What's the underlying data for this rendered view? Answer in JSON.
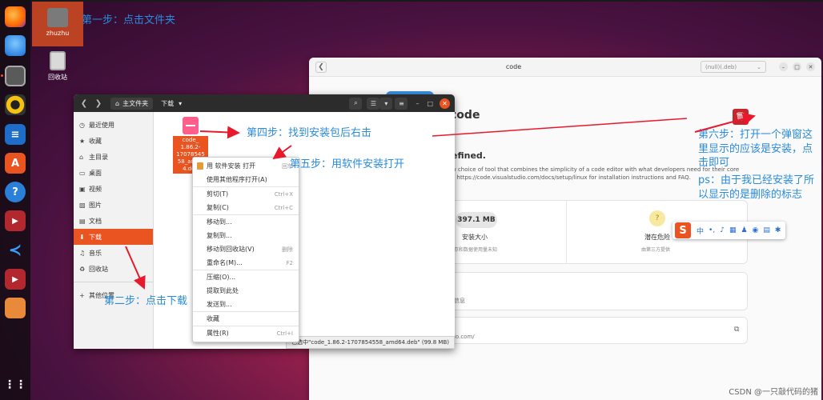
{
  "desktop": {
    "home_folder_label": "zhuzhu",
    "trash_label": "回收站"
  },
  "annotations": {
    "step1": "第一步：点击文件夹",
    "step2": "第二步：点击下载",
    "step4": "第四步：找到安装包后右击",
    "step5": "第五步：用软件安装打开",
    "step6": "第六步：打开一个弹窗这里显示的应该是安装，点击即可",
    "note": "ps：由于我已经安装了所以显示的是删除的标志"
  },
  "software_center": {
    "title": "code",
    "source_select": "(null)(.deb)",
    "app_name": "code",
    "subtitle": "efined.",
    "description_line1": "w choice of tool that combines the simplicity of a code editor with what developers need for their core",
    "description_line2": "e https://code.visualstudio.com/docs/setup/linux for installation instructions and FAQ.",
    "install_size_value": "397.1 MB",
    "install_size_label": "安装大小",
    "install_size_note": "存和数据使用量未知",
    "risk_label": "潜在危险",
    "risk_note": "由第三方提供",
    "info_text": "信息",
    "link_text": "io.com/"
  },
  "file_manager": {
    "path_home": "主文件夹",
    "path_current": "下载",
    "sidebar": [
      {
        "icon": "clock-icon",
        "glyph": "◷",
        "label": "最近使用"
      },
      {
        "icon": "star-icon",
        "glyph": "★",
        "label": "收藏"
      },
      {
        "icon": "home-icon",
        "glyph": "⌂",
        "label": "主目录"
      },
      {
        "icon": "desktop-icon",
        "glyph": "▭",
        "label": "桌面"
      },
      {
        "icon": "video-icon",
        "glyph": "▣",
        "label": "视频"
      },
      {
        "icon": "picture-icon",
        "glyph": "▨",
        "label": "图片"
      },
      {
        "icon": "document-icon",
        "glyph": "▤",
        "label": "文档"
      },
      {
        "icon": "download-icon",
        "glyph": "⬇",
        "label": "下载"
      },
      {
        "icon": "music-icon",
        "glyph": "♫",
        "label": "音乐"
      },
      {
        "icon": "trash-icon",
        "glyph": "♻",
        "label": "回收站"
      },
      {
        "icon": "plus-icon",
        "glyph": "+",
        "label": "其他位置"
      }
    ],
    "file_name": "code_1.86.2-1707854558_amd64.deb",
    "file_name_display": [
      "code_",
      "1.86.2-",
      "17078545",
      "58_amd6",
      "4.deb"
    ],
    "status_text": "已选中\"code_1.86.2-1707854558_amd64.deb\" (99.8 MB)"
  },
  "context_menu": {
    "items": [
      {
        "label": "用 软件安装 打开",
        "shortcut": "回车"
      },
      {
        "label": "使用其他程序打开(A)",
        "shortcut": ""
      },
      {
        "label": "剪切(T)",
        "shortcut": "Ctrl+X"
      },
      {
        "label": "复制(C)",
        "shortcut": "Ctrl+C"
      },
      {
        "label": "移动到...",
        "shortcut": ""
      },
      {
        "label": "复制到...",
        "shortcut": ""
      },
      {
        "label": "移动到回收站(V)",
        "shortcut": "删除"
      },
      {
        "label": "重命名(M)...",
        "shortcut": "F2"
      },
      {
        "label": "压缩(O)...",
        "shortcut": ""
      },
      {
        "label": "提取到此处",
        "shortcut": ""
      },
      {
        "label": "发送到...",
        "shortcut": ""
      },
      {
        "label": "收藏",
        "shortcut": ""
      },
      {
        "label": "属性(R)",
        "shortcut": "Ctrl+I"
      }
    ]
  },
  "ime": {
    "logo": "S",
    "lang": "中"
  },
  "watermark": "CSDN @一只敲代码的猪",
  "colors": {
    "ubuntu_orange": "#e95420",
    "annotation_blue": "#2a8bdb",
    "arrow_red": "#e8192c",
    "delete_red": "#c6262e"
  }
}
